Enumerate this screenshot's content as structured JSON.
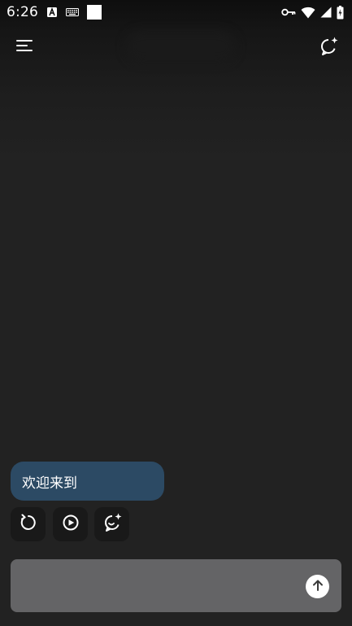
{
  "status_bar": {
    "time": "6:26",
    "left_icons": [
      "font-a-icon",
      "keyboard-icon",
      "white-square-icon"
    ],
    "right_icons": [
      "vpn-key-icon",
      "wifi-icon",
      "cell-signal-icon",
      "battery-icon"
    ]
  },
  "app_bar": {
    "menu_icon": "menu-icon",
    "new_chat_icon": "new-chat-sparkle-icon"
  },
  "chat": {
    "messages": [
      {
        "role": "assistant",
        "text": "欢迎来到"
      }
    ],
    "actions": [
      {
        "name": "regenerate",
        "icon": "refresh-icon"
      },
      {
        "name": "read-aloud",
        "icon": "play-circle-icon"
      },
      {
        "name": "ai-chat",
        "icon": "chat-sparkle-icon"
      }
    ]
  },
  "input": {
    "value": "",
    "placeholder": "",
    "send_icon": "arrow-up-icon"
  },
  "colors": {
    "background": "#222222",
    "bubble": "#2c4a64",
    "input": "#646466",
    "action_button": "#191919"
  }
}
